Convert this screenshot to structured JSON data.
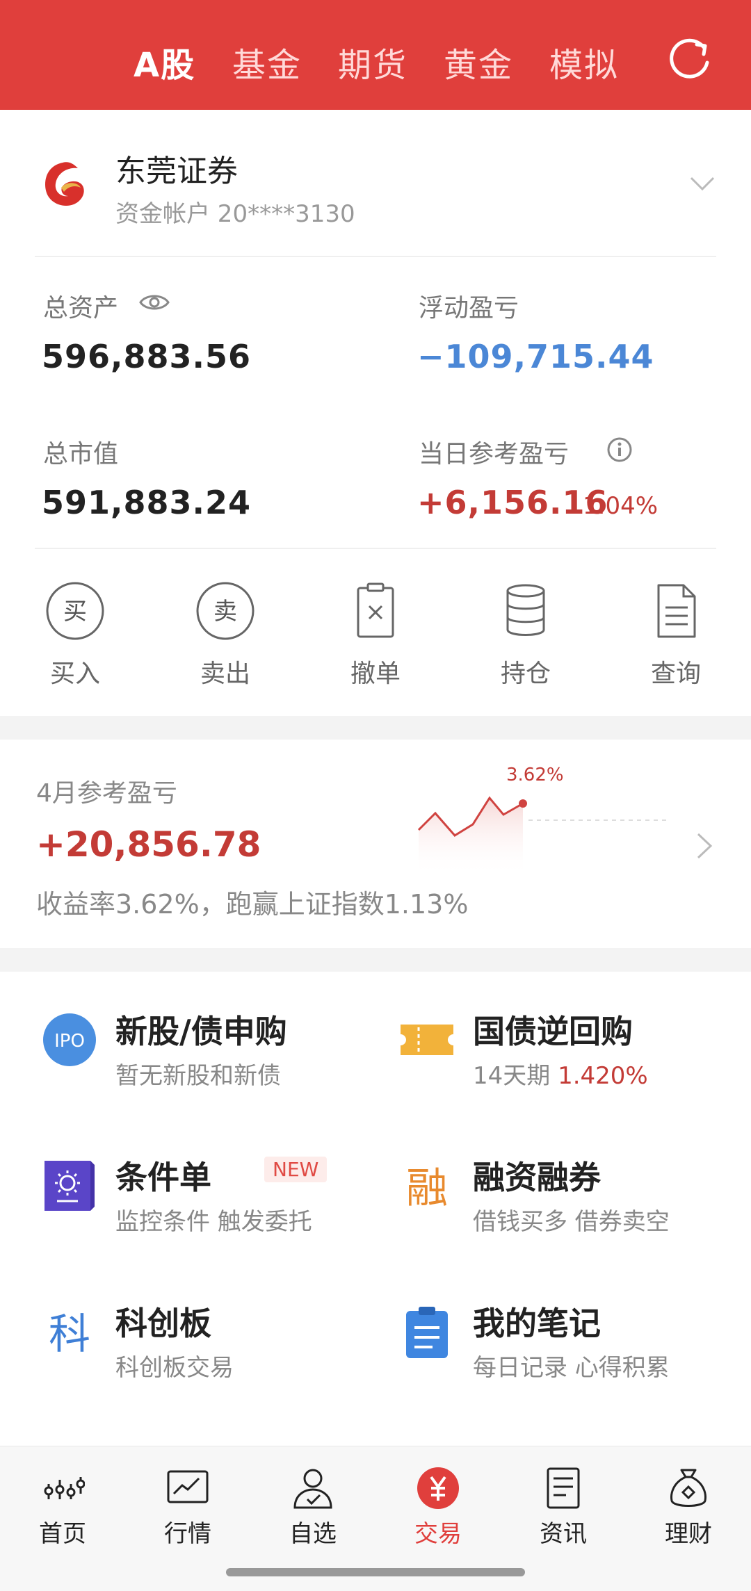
{
  "header": {
    "tabs": [
      "A股",
      "基金",
      "期货",
      "黄金",
      "模拟"
    ],
    "active_tab": "A股",
    "refresh_icon": "refresh-icon"
  },
  "account": {
    "broker": "东莞证券",
    "account_no": "资金帐户 20****3130",
    "total_assets_label": "总资产",
    "total_assets": "596,883.56",
    "floating_pl_label": "浮动盈亏",
    "floating_pl": "−109,715.44",
    "market_value_label": "总市值",
    "market_value": "591,883.24",
    "daily_pl_label": "当日参考盈亏",
    "daily_pl": "+6,156.16",
    "daily_pct": "1.04%"
  },
  "actions": [
    {
      "label": "买入",
      "glyph": "买",
      "icon": "buy-icon"
    },
    {
      "label": "卖出",
      "glyph": "卖",
      "icon": "sell-icon"
    },
    {
      "label": "撤单",
      "icon": "cancel-order-icon"
    },
    {
      "label": "持仓",
      "icon": "holdings-icon"
    },
    {
      "label": "查询",
      "icon": "query-icon"
    }
  ],
  "monthly": {
    "title": "4月参考盈亏",
    "value": "+20,856.78",
    "subtitle": "收益率3.62%，跑赢上证指数1.13%",
    "spark_label": "3.62%"
  },
  "features": [
    {
      "title": "新股/债申购",
      "subtitle": "暂无新股和新债",
      "icon": "ipo-icon",
      "glyph": "IPO"
    },
    {
      "title": "国债逆回购",
      "subtitle_prefix": "14天期 ",
      "subtitle_highlight": "1.420%",
      "icon": "ticket-icon"
    },
    {
      "title": "条件单",
      "tag": "NEW",
      "subtitle": "监控条件 触发委托",
      "icon": "condition-order-icon"
    },
    {
      "title": "融资融券",
      "subtitle": "借钱买多 借券卖空",
      "icon": "margin-icon",
      "glyph": "融"
    },
    {
      "title": "科创板",
      "subtitle": "科创板交易",
      "icon": "star-market-icon",
      "glyph": "科"
    },
    {
      "title": "我的笔记",
      "subtitle": "每日记录 心得积累",
      "icon": "notes-icon"
    }
  ],
  "nav": [
    {
      "label": "首页",
      "icon": "home-icon"
    },
    {
      "label": "行情",
      "icon": "market-icon"
    },
    {
      "label": "自选",
      "icon": "watchlist-icon"
    },
    {
      "label": "交易",
      "icon": "trade-icon",
      "active": true
    },
    {
      "label": "资讯",
      "icon": "news-icon"
    },
    {
      "label": "理财",
      "icon": "wealth-icon"
    }
  ],
  "colors": {
    "brand_red": "#e03f3c",
    "loss_blue": "#4b87d6",
    "gain_red": "#c33b36"
  }
}
